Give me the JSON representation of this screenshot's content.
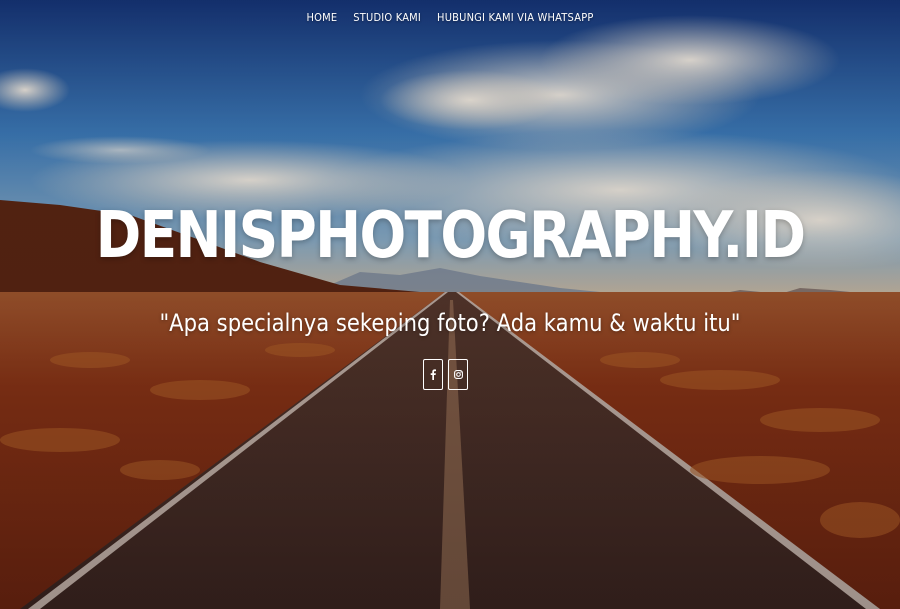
{
  "nav": {
    "items": [
      {
        "label": "HOME"
      },
      {
        "label": "STUDIO KAMI"
      },
      {
        "label": "HUBUNGI KAMI VIA WHATSAPP"
      }
    ]
  },
  "hero": {
    "title": "DENISPHOTOGRAPHY.ID",
    "tagline": "\"Apa specialnya sekeping foto? Ada kamu & waktu itu\""
  },
  "social": {
    "facebook_icon": "facebook-icon",
    "instagram_icon": "instagram-icon"
  },
  "colors": {
    "sky_top": "#1d3f86",
    "sky_mid": "#4a88c6",
    "ground": "#8a2f12",
    "road": "#3b2620",
    "text": "#ffffff"
  }
}
